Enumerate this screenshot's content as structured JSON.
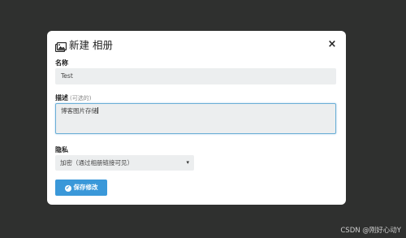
{
  "modal": {
    "title": "新建 相册",
    "title_icon": "photo-album-icon",
    "close_label": "×"
  },
  "form": {
    "name_label": "名称",
    "name_value": "Test",
    "desc_label": "描述",
    "desc_optional": "(可选的)",
    "desc_value": "博客图片存储",
    "privacy_label": "隐私",
    "privacy_selected": "加密（通过相册链接可见）",
    "save_label": "保存修改"
  },
  "watermark": "CSDN @刚好心动Y",
  "colors": {
    "backdrop": "#2f302f",
    "primary": "#3a98d9",
    "input_bg": "#eceeef",
    "focus_border": "#6aaed6"
  }
}
